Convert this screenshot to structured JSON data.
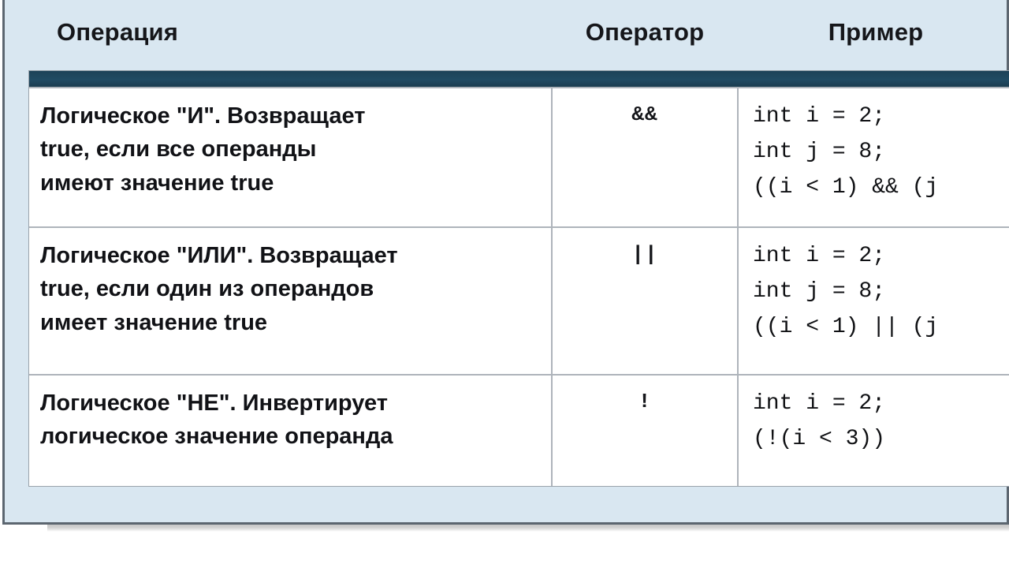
{
  "panel": {
    "background_color": "#d9e7f1",
    "border_color": "#5c6670"
  },
  "table": {
    "top_bar_color": "#1f4a63",
    "grid_color": "#aeb4bb",
    "headers": {
      "operation": "Операция",
      "operator": "Оператор",
      "example": "Пример"
    },
    "rows": [
      {
        "id": "and",
        "operation": "Логическое \"И\". Возвращает\ntrue, если все операнды\nимеют значение true",
        "operator": "&&",
        "example": "int i = 2;\nint j = 8;\n((i < 1) && (j"
      },
      {
        "id": "or",
        "operation": "Логическое \"ИЛИ\". Возвращает\ntrue, если один из операндов\nимеет значение true",
        "operator": "||",
        "example": "int i = 2;\nint j = 8;\n((i < 1) || (j"
      },
      {
        "id": "not",
        "operation": "Логическое \"НЕ\". Инвертирует\nлогическое значение операнда",
        "operator": "!",
        "example": "int i = 2;\n(!(i < 3))"
      }
    ]
  }
}
